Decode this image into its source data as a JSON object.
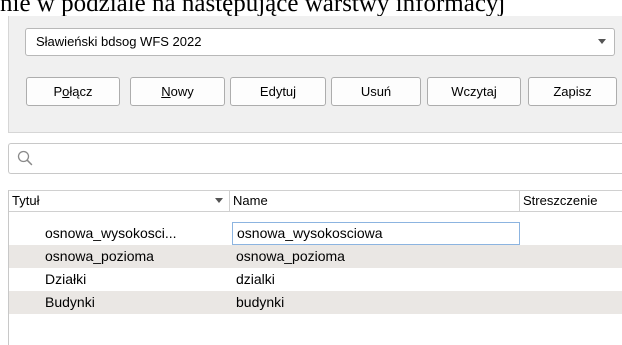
{
  "doc_text": "nie w podziale na następujące warstwy informacyj",
  "connection": {
    "selected": "Sławieński bdsog WFS 2022",
    "buttons": {
      "connect": "Połącz",
      "new": "Nowy",
      "edit": "Edytuj",
      "delete": "Usuń",
      "load": "Wczytaj",
      "save": "Zapisz"
    }
  },
  "search": {
    "value": "",
    "icon": "search-icon"
  },
  "table": {
    "columns": [
      "Tytuł",
      "Name",
      "Streszczenie"
    ],
    "rows": [
      {
        "title": "osnowa_wysokosci...",
        "name": "osnowa_wysokosciowa"
      },
      {
        "title": "osnowa_pozioma",
        "name": "osnowa_pozioma"
      },
      {
        "title": "Działki",
        "name": "dzialki"
      },
      {
        "title": "Budynki",
        "name": "budynki"
      }
    ]
  }
}
